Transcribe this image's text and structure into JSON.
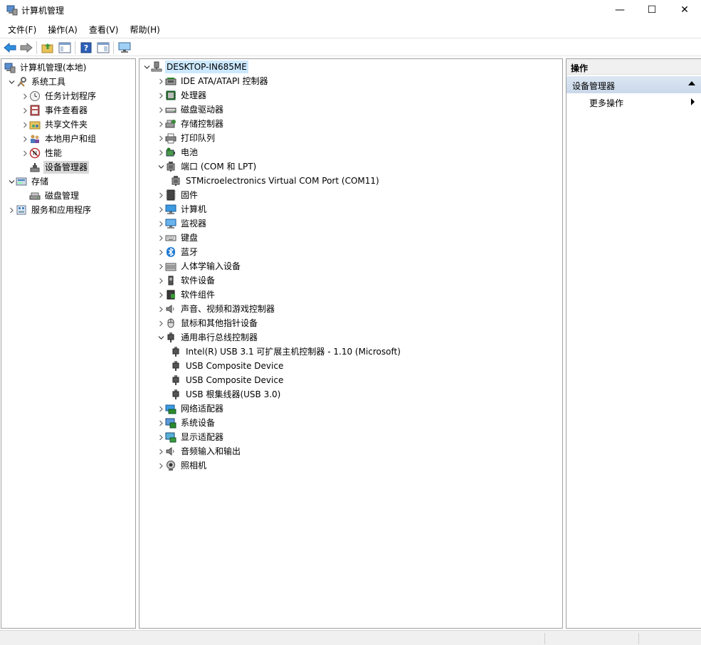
{
  "window": {
    "title": "计算机管理",
    "icon": "computer-management-icon",
    "controls": {
      "minimize": "—",
      "maximize": "☐",
      "close": "✕"
    }
  },
  "menu": [
    "文件(F)",
    "操作(A)",
    "查看(V)",
    "帮助(H)"
  ],
  "toolbar": {
    "buttons": [
      "back-arrow-icon",
      "forward-arrow-icon",
      "up-folder-icon",
      "show-hide-tree-icon",
      "help-icon",
      "properties-icon",
      "monitor-icon"
    ]
  },
  "left_tree": [
    {
      "label": "计算机管理(本地)",
      "icon": "computer-management-icon",
      "level": 0,
      "chevron": ""
    },
    {
      "label": "系统工具",
      "icon": "tools-icon",
      "level": 1,
      "chevron": "expanded"
    },
    {
      "label": "任务计划程序",
      "icon": "clock-icon",
      "level": 2,
      "chevron": "collapsed"
    },
    {
      "label": "事件查看器",
      "icon": "event-viewer-icon",
      "level": 2,
      "chevron": "collapsed"
    },
    {
      "label": "共享文件夹",
      "icon": "shared-folder-icon",
      "level": 2,
      "chevron": "collapsed"
    },
    {
      "label": "本地用户和组",
      "icon": "users-icon",
      "level": 2,
      "chevron": "collapsed"
    },
    {
      "label": "性能",
      "icon": "performance-icon",
      "level": 2,
      "chevron": "collapsed"
    },
    {
      "label": "设备管理器",
      "icon": "device-manager-icon",
      "level": 2,
      "chevron": "",
      "selected": true
    },
    {
      "label": "存储",
      "icon": "storage-icon",
      "level": 1,
      "chevron": "expanded"
    },
    {
      "label": "磁盘管理",
      "icon": "disk-icon",
      "level": 2,
      "chevron": ""
    },
    {
      "label": "服务和应用程序",
      "icon": "services-icon",
      "level": 1,
      "chevron": "collapsed"
    }
  ],
  "device_tree": {
    "root": "DESKTOP-IN685ME",
    "items": [
      {
        "label": "IDE ATA/ATAPI 控制器",
        "icon": "ide-controller-icon",
        "level": 1,
        "chevron": "collapsed"
      },
      {
        "label": "处理器",
        "icon": "processor-icon",
        "level": 1,
        "chevron": "collapsed"
      },
      {
        "label": "磁盘驱动器",
        "icon": "disk-drive-icon",
        "level": 1,
        "chevron": "collapsed"
      },
      {
        "label": "存储控制器",
        "icon": "storage-controller-icon",
        "level": 1,
        "chevron": "collapsed"
      },
      {
        "label": "打印队列",
        "icon": "printer-icon",
        "level": 1,
        "chevron": "collapsed"
      },
      {
        "label": "电池",
        "icon": "battery-icon",
        "level": 1,
        "chevron": "collapsed"
      },
      {
        "label": "端口 (COM 和 LPT)",
        "icon": "port-icon",
        "level": 1,
        "chevron": "expanded"
      },
      {
        "label": "STMicroelectronics Virtual COM Port (COM11)",
        "icon": "port-icon",
        "level": 2,
        "chevron": ""
      },
      {
        "label": "固件",
        "icon": "firmware-icon",
        "level": 1,
        "chevron": "collapsed"
      },
      {
        "label": "计算机",
        "icon": "computer-icon",
        "level": 1,
        "chevron": "collapsed"
      },
      {
        "label": "监视器",
        "icon": "monitor-icon",
        "level": 1,
        "chevron": "collapsed"
      },
      {
        "label": "键盘",
        "icon": "keyboard-icon",
        "level": 1,
        "chevron": "collapsed"
      },
      {
        "label": "蓝牙",
        "icon": "bluetooth-icon",
        "level": 1,
        "chevron": "collapsed"
      },
      {
        "label": "人体学输入设备",
        "icon": "hid-icon",
        "level": 1,
        "chevron": "collapsed"
      },
      {
        "label": "软件设备",
        "icon": "software-device-icon",
        "level": 1,
        "chevron": "collapsed"
      },
      {
        "label": "软件组件",
        "icon": "software-component-icon",
        "level": 1,
        "chevron": "collapsed"
      },
      {
        "label": "声音、视频和游戏控制器",
        "icon": "speaker-icon",
        "level": 1,
        "chevron": "collapsed"
      },
      {
        "label": "鼠标和其他指针设备",
        "icon": "mouse-icon",
        "level": 1,
        "chevron": "collapsed"
      },
      {
        "label": "通用串行总线控制器",
        "icon": "usb-icon",
        "level": 1,
        "chevron": "expanded"
      },
      {
        "label": "Intel(R) USB 3.1 可扩展主机控制器 - 1.10 (Microsoft)",
        "icon": "usb-icon",
        "level": 2,
        "chevron": ""
      },
      {
        "label": "USB Composite Device",
        "icon": "usb-icon",
        "level": 2,
        "chevron": ""
      },
      {
        "label": "USB Composite Device",
        "icon": "usb-icon",
        "level": 2,
        "chevron": ""
      },
      {
        "label": "USB 根集线器(USB 3.0)",
        "icon": "usb-icon",
        "level": 2,
        "chevron": ""
      },
      {
        "label": "网络适配器",
        "icon": "network-adapter-icon",
        "level": 1,
        "chevron": "collapsed"
      },
      {
        "label": "系统设备",
        "icon": "system-device-icon",
        "level": 1,
        "chevron": "collapsed"
      },
      {
        "label": "显示适配器",
        "icon": "display-adapter-icon",
        "level": 1,
        "chevron": "collapsed"
      },
      {
        "label": "音频输入和输出",
        "icon": "speaker-icon",
        "level": 1,
        "chevron": "collapsed"
      },
      {
        "label": "照相机",
        "icon": "camera-icon",
        "level": 1,
        "chevron": "collapsed"
      }
    ]
  },
  "actions": {
    "header": "操作",
    "section": "设备管理器",
    "item": "更多操作"
  },
  "colors": {
    "selected_root_bg": "#cce8ff",
    "selected_item_bg": "#d9d9d9",
    "action_section_bg": "#d3dfee",
    "accent_blue": "#1e78d2"
  }
}
